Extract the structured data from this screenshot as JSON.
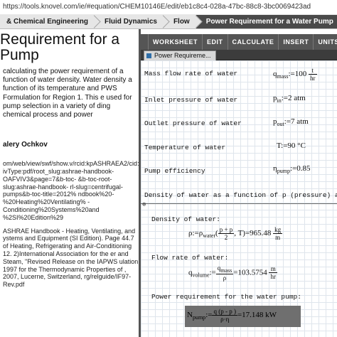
{
  "address": "https://tools.knovel.com/ie/#equation/CHEM10146E/edit/eb1c8c4-028a-47bc-88c8-3bc0069423ad",
  "breadcrumbs": [
    "& Chemical Engineering",
    "Fluid Dynamics",
    "Flow",
    "Power Requirement for a Water Pump",
    "≡"
  ],
  "page": {
    "title_line1": "Requirement for a",
    "title_line2": "Pump",
    "description": "calculating the power requirement of a function of water density. Water density a function of its temperature and PWS Formulation for Region 1. This e used for pump selection in a variety of ding chemical process and power",
    "author": "alery Ochkov",
    "refs": [
      "om/web/view/swf/show.v/rcid:kpASHRAEA2/cid: ivType:pdf/root_slug:ashrae-handbook- OAFVIV3&page=7&b-toc- &b-toc-root-slug:ashrae-handbook- rl-slug=centrifugal-pumps&b-toc-title=2012% ndbook%20-%20Heating%20Ventilating% -Conditioning%20Systems%20and %2SI%20Edition%29",
      "ASHRAE Handbook - Heating, Ventilating, and ystems and Equipment (SI Edition). Page 44.7 of Heating, Refrigerating and Air-Conditioning 12. 2)International Association for the er and Steam, \"Revised Release on the IAPWS ulation 1997 for the Thermodynamic Properties of , 2007, Lucerne, Switzerland, rg/relguide/IF97-Rev.pdf"
    ]
  },
  "toolbar": [
    "WORKSHEET",
    "EDIT",
    "CALCULATE",
    "INSERT",
    "UNITS"
  ],
  "worksheet_tab": "Power Requireme...",
  "worksheet": {
    "mass_flow_label": "Mass flow rate of water",
    "mass_flow_lhs": "q",
    "mass_flow_sub": "mass",
    "mass_flow_value": "100",
    "mass_flow_unit_num": "t",
    "mass_flow_unit_den": "hr",
    "inlet_label": "Inlet pressure of water",
    "inlet_lhs": "p",
    "inlet_sub": "in",
    "inlet_value": "2 atm",
    "outlet_label": "Outlet pressure of water",
    "outlet_lhs": "p",
    "outlet_sub": "out",
    "outlet_value": "7 atm",
    "temp_label": "Temperature of water",
    "temp_eq": "T:=90 °C",
    "eff_label": "Pump efficiency",
    "eff_lhs": "η",
    "eff_sub": "pump",
    "eff_value": "0.85",
    "density_heading": "Density of water as a function of p (pressure) and T",
    "density_label": "Density of water:",
    "density_lhs": "ρ:=ρ",
    "density_sub": "water",
    "density_num": "p  + p",
    "density_den": "2",
    "density_result": "965.48",
    "density_unit_num": "kg",
    "density_unit_den": "m",
    "flow_label": "Flow rate of water:",
    "flow_lhs": "q",
    "flow_sub": "volume",
    "flow_num": "q",
    "flow_num_sub": "mass",
    "flow_den": "ρ",
    "flow_result": "103.5754",
    "flow_unit_num": "m",
    "flow_unit_den": "hr",
    "power_label": "Power requirement for the water pump:",
    "power_lhs": "N",
    "power_sub": "pump",
    "power_num": "q    (p    - p  )",
    "power_den": "ρ·η",
    "power_result": "17.148 kW"
  }
}
